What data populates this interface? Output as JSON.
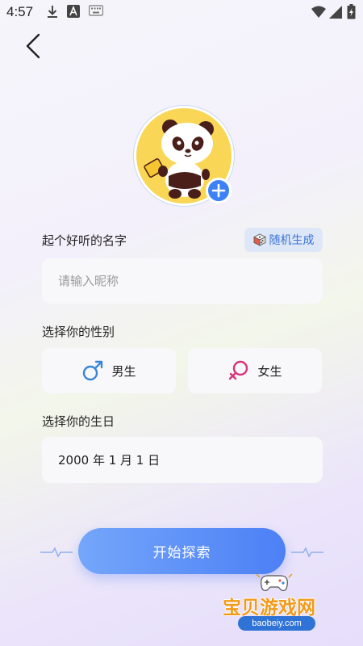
{
  "status_bar": {
    "time": "4:57",
    "icons": [
      "download-icon",
      "a-icon",
      "keyboard-icon",
      "wifi-icon",
      "signal-icon",
      "battery-icon"
    ]
  },
  "header": {
    "back_icon": "chevron-left-icon"
  },
  "avatar": {
    "image": "panda-avatar",
    "add_icon": "plus-icon"
  },
  "name_section": {
    "label": "起个好听的名字",
    "random_button": {
      "icon": "dice-icon",
      "label": "随机生成"
    },
    "input_value": "",
    "input_placeholder": "请输入昵称"
  },
  "gender_section": {
    "label": "选择你的性别",
    "options": [
      {
        "label": "男生",
        "icon": "male-symbol-icon",
        "color": "#3a86d6"
      },
      {
        "label": "女生",
        "icon": "female-symbol-icon",
        "color": "#d9347a"
      }
    ]
  },
  "birthday_section": {
    "label": "选择你的生日",
    "value": "2000 年 1 月 1 日"
  },
  "start_button": {
    "label": "开始探索"
  },
  "watermark": {
    "title": "宝贝游戏网",
    "url": "baobeiy.com"
  },
  "colors": {
    "accent": "#4c80f5",
    "background": "#f3f0fb"
  }
}
